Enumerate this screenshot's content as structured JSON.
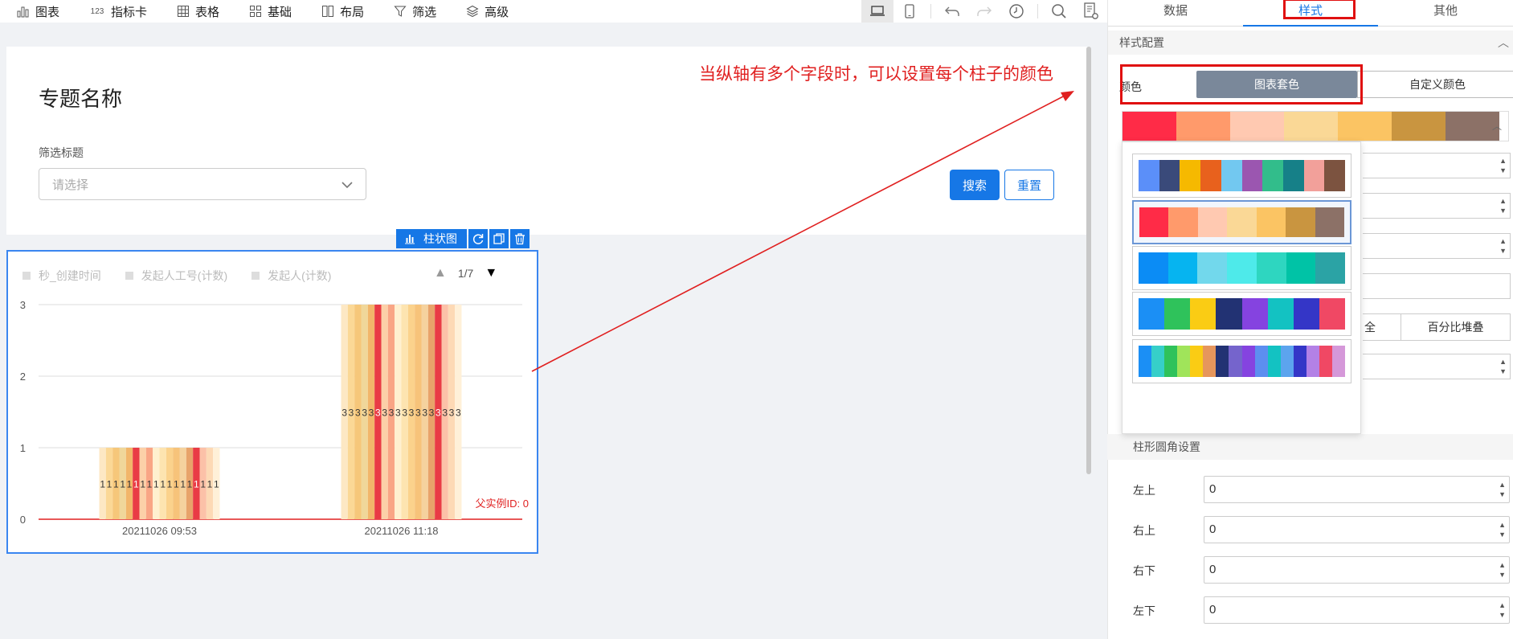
{
  "toolbar": {
    "items": [
      {
        "label": "图表",
        "icon": "bar-chart-icon"
      },
      {
        "label": "指标卡",
        "icon": "number-icon"
      },
      {
        "label": "表格",
        "icon": "table-icon"
      },
      {
        "label": "基础",
        "icon": "grid-icon"
      },
      {
        "label": "布局",
        "icon": "layout-icon"
      },
      {
        "label": "筛选",
        "icon": "filter-icon"
      },
      {
        "label": "高级",
        "icon": "layers-icon"
      }
    ],
    "number_glyph": "123"
  },
  "page": {
    "title": "专题名称",
    "filter_label": "筛选标题",
    "select_placeholder": "请选择",
    "search_label": "搜索",
    "reset_label": "重置",
    "annotation": "当纵轴有多个字段时，可以设置每个柱子的颜色"
  },
  "widget": {
    "tag_label": "柱状图",
    "legend": [
      "秒_创建时间",
      "发起人工号(计数)",
      "发起人(计数)"
    ],
    "pager": "1/7",
    "parent_id": "父实例ID: 0"
  },
  "chart_data": {
    "type": "bar",
    "categories": [
      "20211026 09:53",
      "20211026 11:18"
    ],
    "series_count": 18,
    "values_by_category": [
      [
        1,
        1,
        1,
        1,
        1,
        1,
        1,
        1,
        1,
        1,
        1,
        1,
        1,
        1,
        1,
        1,
        1,
        1
      ],
      [
        3,
        3,
        3,
        3,
        3,
        3,
        3,
        3,
        3,
        3,
        3,
        3,
        3,
        3,
        3,
        3,
        3,
        3
      ]
    ],
    "ylim": [
      0,
      3
    ],
    "yticks": [
      0,
      1,
      2,
      3
    ],
    "bar_colors": [
      "#fde8c4",
      "#fbd896",
      "#f6c77a",
      "#f0d79a",
      "#f2b66a",
      "#e93b45",
      "#fcd0a8",
      "#f9a585",
      "#fff0cf",
      "#fde4b0",
      "#fbd28c",
      "#f7c37a",
      "#f5d29e",
      "#e8a36a",
      "#e93b45",
      "#fcc1a8",
      "#fdd9b5",
      "#fff0d8"
    ]
  },
  "right_panel": {
    "tabs": [
      "数据",
      "样式",
      "其他"
    ],
    "active_tab": "样式",
    "section_title": "样式配置",
    "color_label": "颜色",
    "color_mode_1": "图表套色",
    "color_mode_2": "自定义颜色",
    "current_palette": [
      "#ff2b47",
      "#ff9a6b",
      "#ffc9b1",
      "#fad896",
      "#fbc463",
      "#c99540",
      "#8c7167"
    ],
    "palette_options": [
      [
        "#5b8ff9",
        "#3a4a7a",
        "#f6b900",
        "#e8611d",
        "#72c8f0",
        "#9b56b0",
        "#32bd8b",
        "#168088",
        "#f2a09a",
        "#7c5340"
      ],
      [
        "#ff2b47",
        "#ff9a6b",
        "#ffc9b1",
        "#fad896",
        "#fbc463",
        "#c99540",
        "#8c7167"
      ],
      [
        "#0b8cf5",
        "#06b4f0",
        "#72d8ec",
        "#4eeaea",
        "#2ed6c0",
        "#00c3a6",
        "#2ba3a5"
      ],
      [
        "#1b8ff5",
        "#2fc25b",
        "#facc14",
        "#223273",
        "#8543e0",
        "#13c2c2",
        "#3436c7",
        "#f04864"
      ],
      [
        "#1b8ff5",
        "#36cfc9",
        "#2fc25b",
        "#a0e45a",
        "#facc14",
        "#e6965c",
        "#223273",
        "#7564cc",
        "#8543e0",
        "#5c8ef0",
        "#13c2c2",
        "#5ca4ee",
        "#3436c7",
        "#b381e6",
        "#f04864",
        "#d598d9"
      ]
    ],
    "stack_label_partial": "全",
    "stack_percent": "百分比堆叠",
    "corner_section": "柱形圆角设置",
    "corners": [
      {
        "label": "左上",
        "value": "0"
      },
      {
        "label": "右上",
        "value": "0"
      },
      {
        "label": "右下",
        "value": "0"
      },
      {
        "label": "左下",
        "value": "0"
      }
    ]
  }
}
